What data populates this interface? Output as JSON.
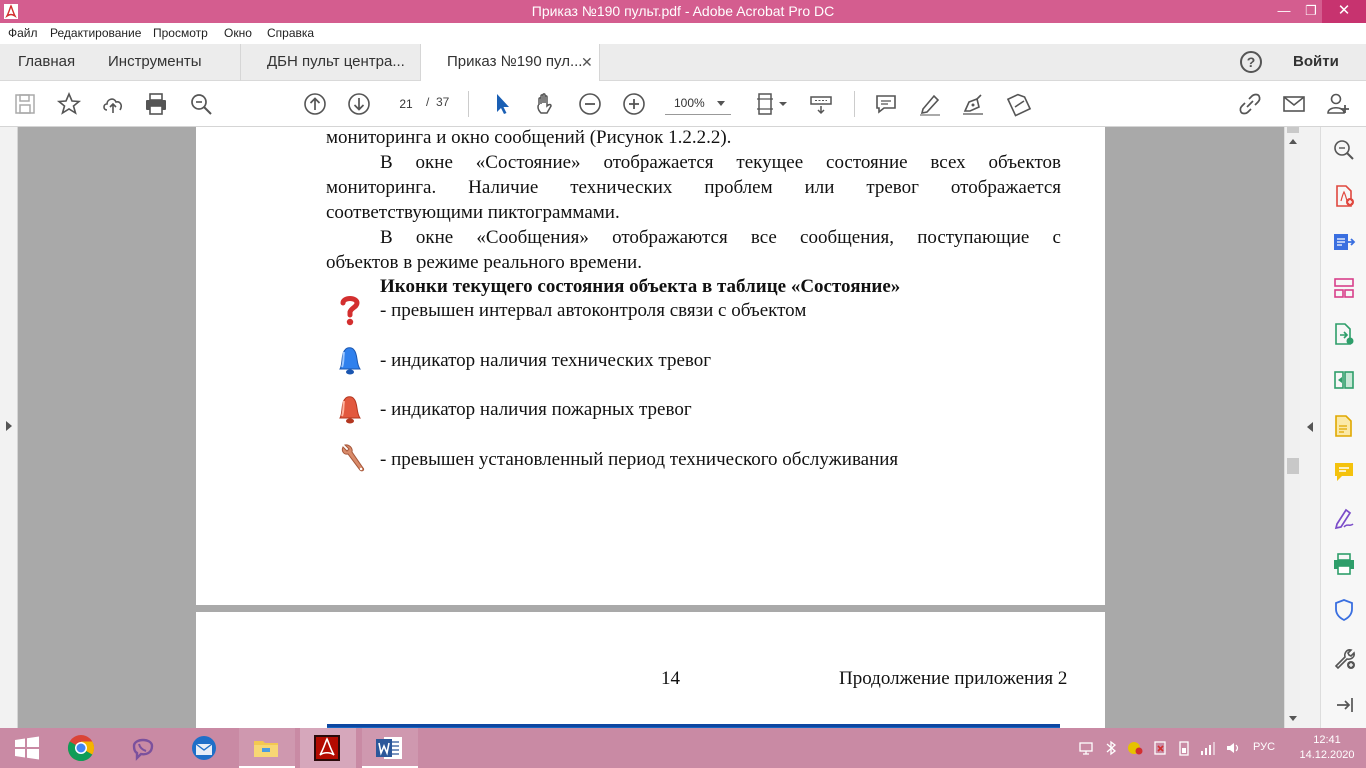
{
  "window": {
    "title": "Приказ №190 пульт.pdf - Adobe Acrobat Pro DC",
    "minimize": "—",
    "maximize": "❐",
    "close": "✕"
  },
  "menu": {
    "items": [
      "Файл",
      "Редактирование",
      "Просмотр",
      "Окно",
      "Справка"
    ]
  },
  "tabs": {
    "home": "Главная",
    "tools": "Инструменты",
    "doc1": "ДБН пульт центра...",
    "doc2": "Приказ №190 пул...",
    "close_glyph": "✕",
    "help_glyph": "?",
    "signin": "Войти"
  },
  "toolbar": {
    "current_page": "21",
    "page_sep": "/",
    "total_pages": "37",
    "zoom": "100%",
    "icons": [
      "save-icon",
      "bookmark-star-icon",
      "upload-cloud-icon",
      "print-icon",
      "search-zoom-icon",
      "page-up-icon",
      "page-down-icon",
      "select-arrow-icon",
      "hand-icon",
      "zoom-out-icon",
      "zoom-in-icon",
      "fit-page-icon",
      "scroll-mode-icon",
      "comment-icon",
      "highlight-pen-icon",
      "sign-pen-icon",
      "fill-sign-icon",
      "link-icon",
      "email-icon",
      "add-user-icon"
    ]
  },
  "document": {
    "lines": {
      "l1": "мониторинга и окно сообщений (Рисунок 1.2.2.2).",
      "l2": "В окне «Состояние» отображается текущее состояние всех объектов",
      "l3": "мониторинга. Наличие технических проблем или тревог отображается",
      "l4": "соответствующими пиктограммами.",
      "l5": "В окне «Сообщения» отображаются все сообщения, поступающие с",
      "l6": "объектов в режиме реального времени.",
      "heading": "Иконки текущего состояния объекта в таблице «Состояние»",
      "item1": "- превышен интервал автоконтроля связи с объектом",
      "item2": "- индикатор наличия технических тревог",
      "item3": "- индикатор наличия пожарных тревог",
      "item4": "- превышен установленный период технического обслуживания"
    },
    "page2": {
      "page_number": "14",
      "continuation": "Продолжение приложения 2"
    },
    "icon_names": [
      "question-mark-icon",
      "blue-bell-icon",
      "red-bell-icon",
      "wrench-icon"
    ],
    "colors": {
      "question": "#d32f2f",
      "blue_bell": "#2f80ed",
      "red_bell": "#e2583e",
      "wrench": "#d98b6a"
    }
  },
  "rightpane": {
    "icons": [
      "enhance-scan-icon",
      "create-pdf-icon",
      "export-pdf-icon",
      "organize-pages-icon",
      "combine-files-icon",
      "compare-icon",
      "edit-pdf-icon",
      "comment-tool-icon",
      "fill-sign-tool-icon",
      "print-production-icon",
      "protect-icon",
      "more-tools-icon",
      "collapse-pane-icon"
    ]
  },
  "taskbar": {
    "apps": [
      "windows-start-icon",
      "chrome-icon",
      "viber-icon",
      "thunderbird-icon",
      "file-explorer-icon",
      "acrobat-icon",
      "word-icon"
    ],
    "lang": "РУС",
    "time": "12:41",
    "date": "14.12.2020"
  },
  "theme": {
    "titlebar": "#d45d8f",
    "taskbar": "#c98aa4",
    "accent_blue": "#1565c0"
  }
}
